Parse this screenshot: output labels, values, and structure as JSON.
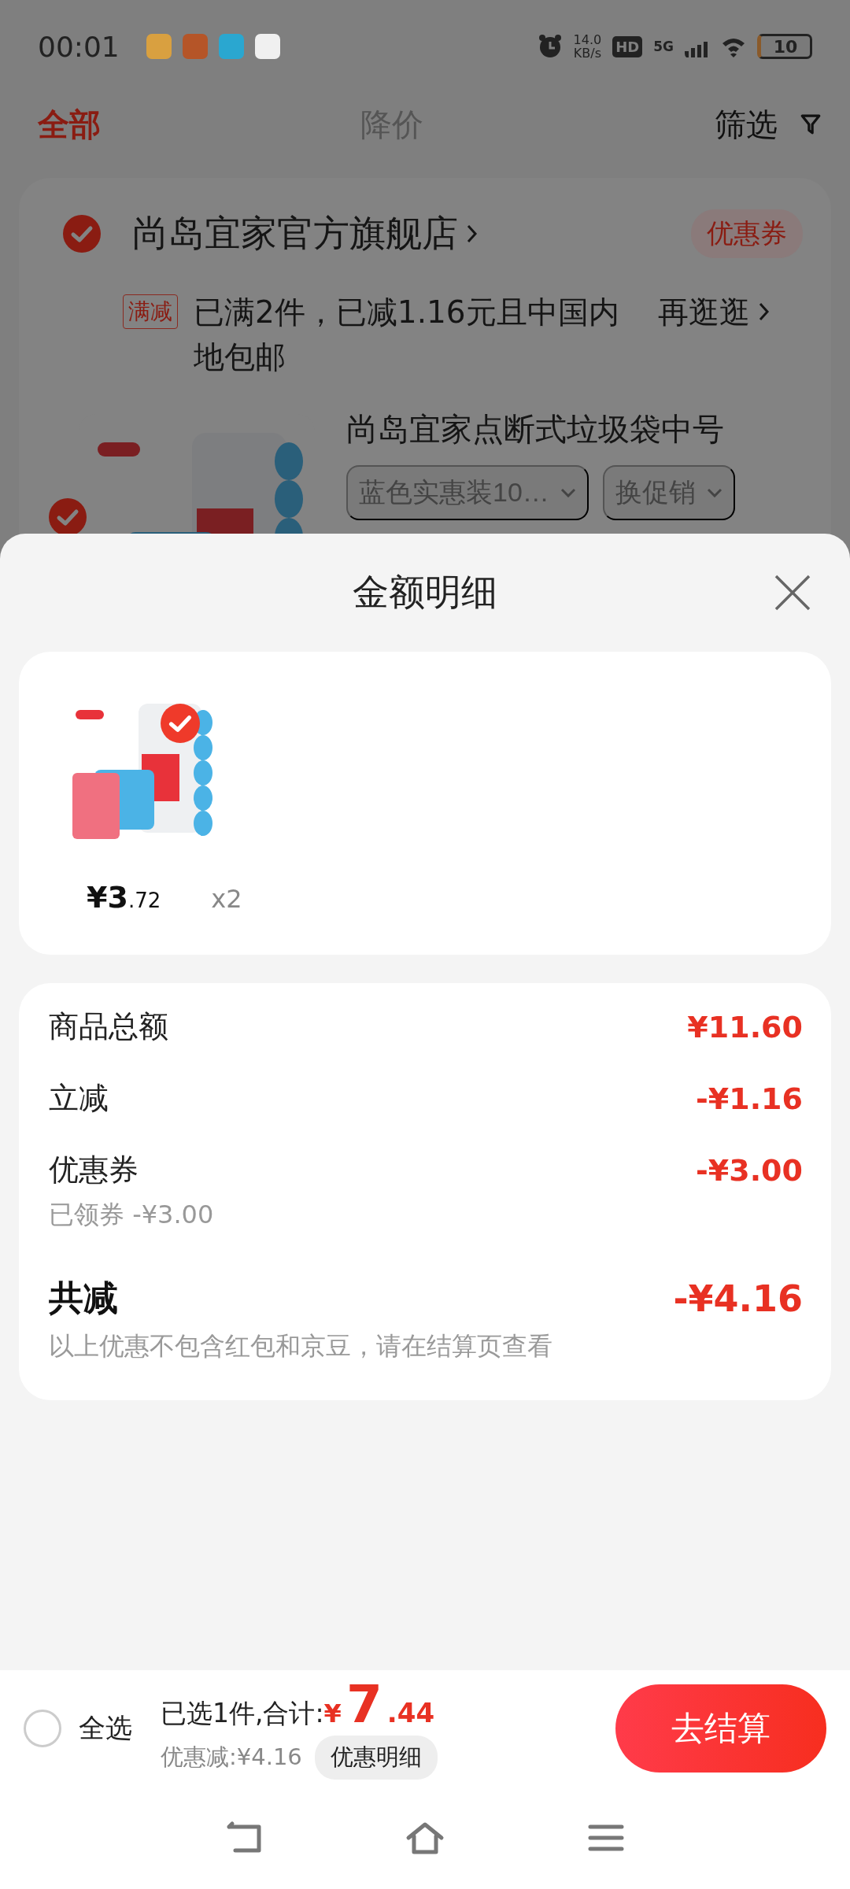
{
  "status_bar": {
    "time": "00:01",
    "net_speed": "14.0",
    "net_unit": "KB/s",
    "hd": "HD",
    "network": "5G",
    "battery": "10"
  },
  "tabs": [
    {
      "label": "全部",
      "selected": true
    },
    {
      "label": "降价",
      "selected": false
    }
  ],
  "filter": "筛选",
  "store": {
    "checked": true,
    "name": "尚岛宜家官方旗舰店",
    "coupon": "优惠券"
  },
  "promo": {
    "tag": "满减",
    "text": "已满2件，已减1.16元且中国内地包邮",
    "action": "再逛逛"
  },
  "product": {
    "checked": true,
    "title": "尚岛宜家点断式垃圾袋中号",
    "variant": "蓝色实惠装10…",
    "promo_select": "换促销"
  },
  "sheet": {
    "title": "金额明细",
    "items": [
      {
        "selected": true,
        "price_int": "¥3",
        "price_dec": ".72",
        "qty": "x2"
      }
    ],
    "summary": [
      {
        "kind": "line",
        "label": "商品总额",
        "amount": "¥11.60"
      },
      {
        "kind": "line",
        "label": "立减",
        "amount": "-¥1.16"
      },
      {
        "kind": "line",
        "label": "优惠券",
        "amount": "-¥3.00",
        "note": "已领券 -¥3.00"
      },
      {
        "kind": "total",
        "label": "共减",
        "amount": "-¥4.16",
        "note": "以上优惠不包含红包和京豆，请在结算页查看"
      }
    ]
  },
  "bottom_bar": {
    "select_all": {
      "label": "全选",
      "checked": false
    },
    "summary": "已选1件,合计:",
    "currency": "¥",
    "total_int": "7",
    "total_dec": ".44",
    "saving": "优惠减:¥4.16",
    "detail_button": "优惠明细",
    "checkout": "去结算"
  }
}
